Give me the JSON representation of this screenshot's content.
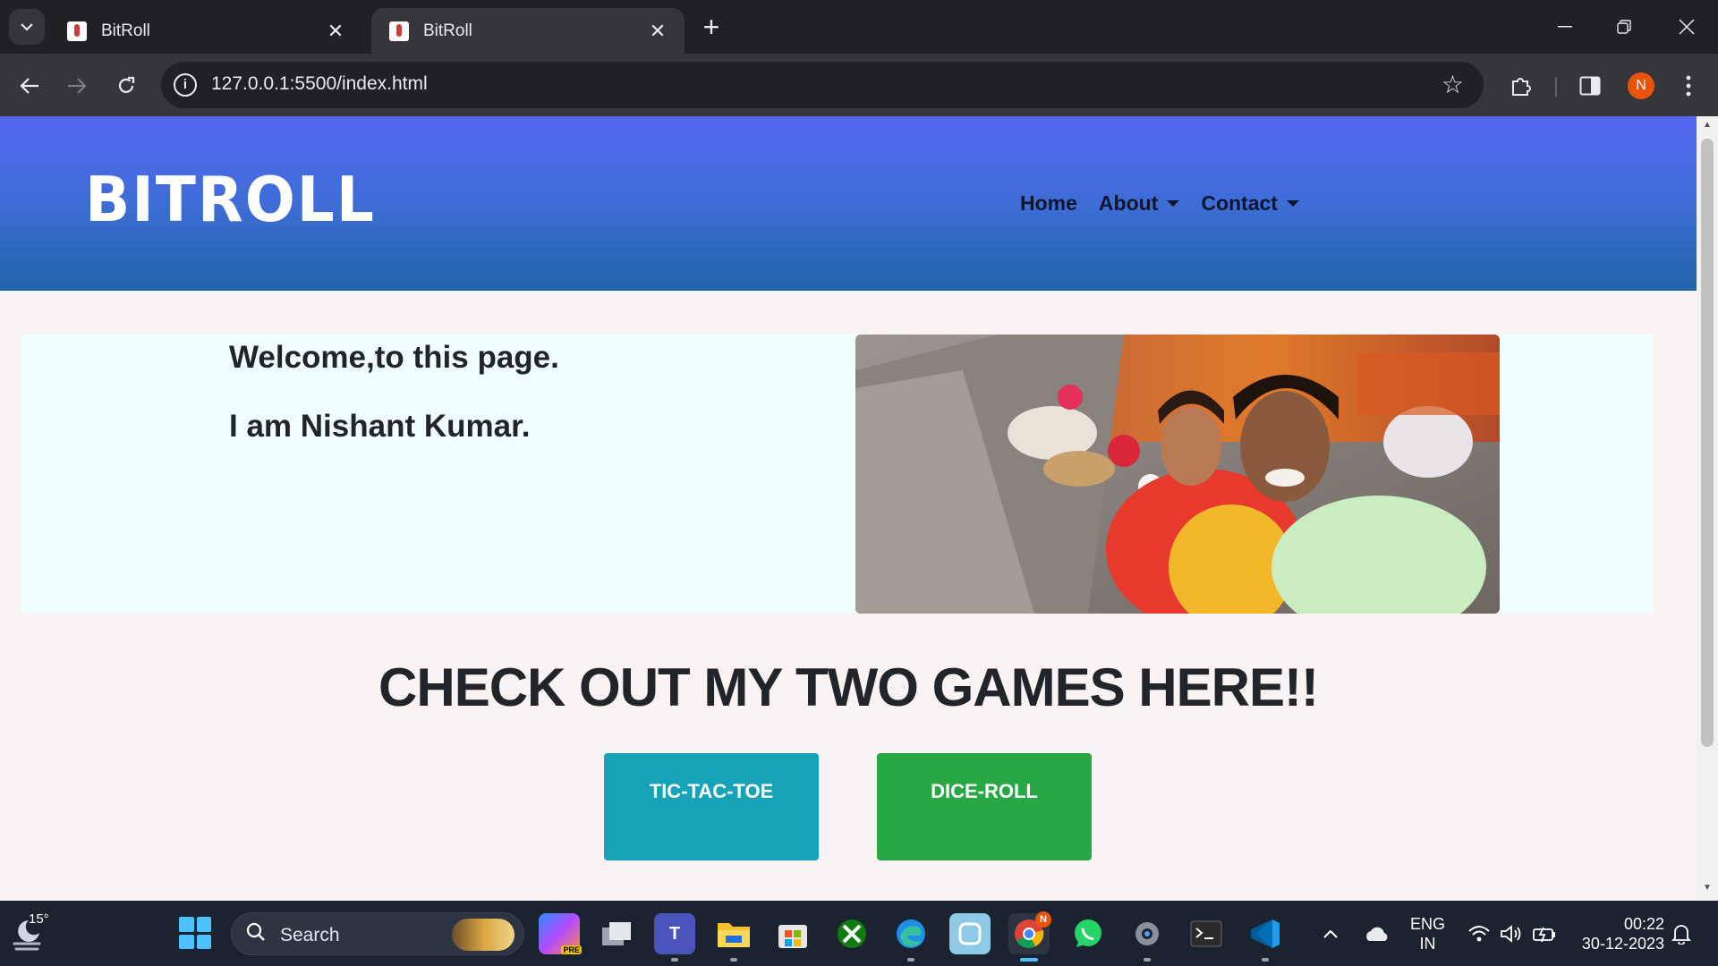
{
  "browser": {
    "tabs": [
      {
        "title": "BitRoll",
        "close": "✕"
      },
      {
        "title": "BitRoll",
        "close": "✕"
      }
    ],
    "new_tab": "+",
    "url": "127.0.0.1:5500/index.html",
    "profile_initial": "N"
  },
  "site": {
    "logo": "BITROLL",
    "nav": {
      "home": "Home",
      "about": "About",
      "contact": "Contact"
    },
    "intro": {
      "welcome": "Welcome,to this page.",
      "name": "I am Nishant Kumar."
    },
    "games_heading": "CHECK OUT MY TWO GAMES HERE!!",
    "games": {
      "tictactoe": "TIC-TAC-TOE",
      "diceroll": "DICE-ROLL"
    }
  },
  "taskbar": {
    "weather_temp": "15°",
    "search_label": "Search",
    "lang_top": "ENG",
    "lang_bottom": "IN",
    "time": "00:22",
    "date": "30-12-2023",
    "chrome_badge": "N",
    "copilot_badge": "PRE"
  },
  "colors": {
    "header_top": "#5466f2",
    "header_bottom": "#2064a8",
    "tictactoe_button": "#17a2b8",
    "diceroll_button": "#28a745"
  }
}
